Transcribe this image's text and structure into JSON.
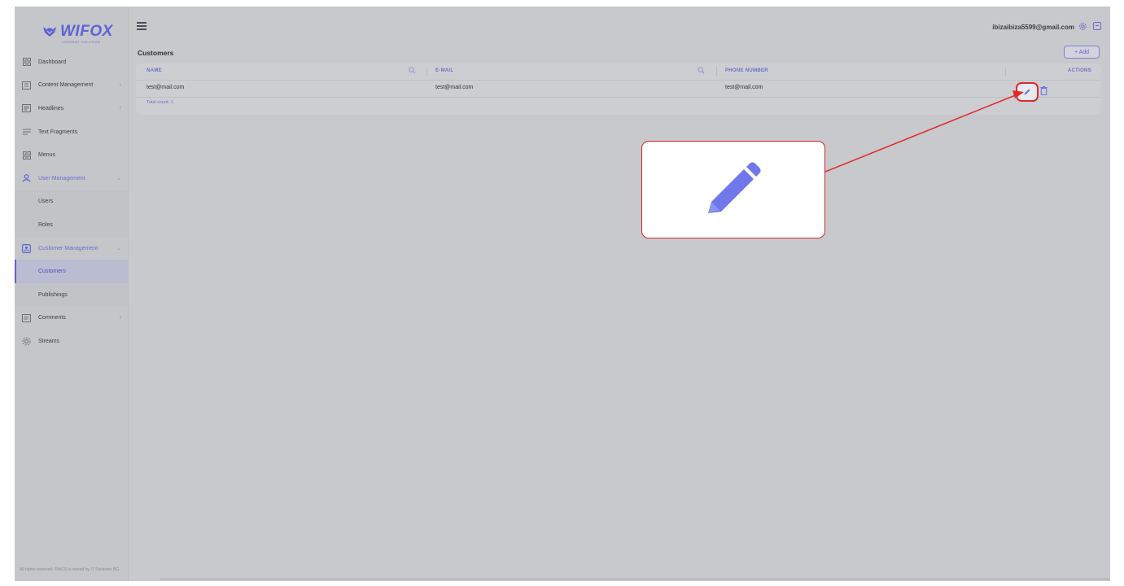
{
  "brand": {
    "name": "WIFOX",
    "tagline": "CONTENT SOLUTION",
    "color": "#5d63d6"
  },
  "topbar": {
    "user_email": "ibizaibiza5599@gmail.com",
    "settings_icon": "gear-icon",
    "logout_icon": "logout-icon"
  },
  "sidebar": {
    "items": [
      {
        "label": "Dashboard",
        "icon": "dashboard-icon",
        "has_chevron": false
      },
      {
        "label": "Content Management",
        "icon": "content-icon",
        "has_chevron": true
      },
      {
        "label": "Headlines",
        "icon": "headlines-icon",
        "has_chevron": true
      },
      {
        "label": "Text Fragments",
        "icon": "text-icon",
        "has_chevron": false
      },
      {
        "label": "Menus",
        "icon": "menus-icon",
        "has_chevron": false
      },
      {
        "label": "User Management",
        "icon": "users-icon",
        "has_chevron": true,
        "expanded": true,
        "children": [
          {
            "label": "Users"
          },
          {
            "label": "Roles"
          }
        ]
      },
      {
        "label": "Customer Management",
        "icon": "customer-icon",
        "has_chevron": true,
        "expanded": true,
        "children": [
          {
            "label": "Customers",
            "active": true
          },
          {
            "label": "Publishings"
          }
        ]
      },
      {
        "label": "Comments",
        "icon": "comments-icon",
        "has_chevron": true
      },
      {
        "label": "Streams",
        "icon": "streams-icon",
        "has_chevron": false
      }
    ],
    "footer": "All rights reserved. ®WCS is owned by IT Solutions BG"
  },
  "page": {
    "title": "Customers",
    "add_label": "+ Add",
    "table": {
      "columns": [
        "NAME",
        "E-MAIL",
        "PHONE NUMBER",
        "ACTIONS"
      ],
      "rows": [
        [
          "test@mail.com",
          "test@mail.com",
          "test@mail.com"
        ]
      ],
      "total_count": "Total count: 1"
    }
  },
  "annotation": {
    "highlight": "edit-button",
    "color": "#e02828"
  }
}
